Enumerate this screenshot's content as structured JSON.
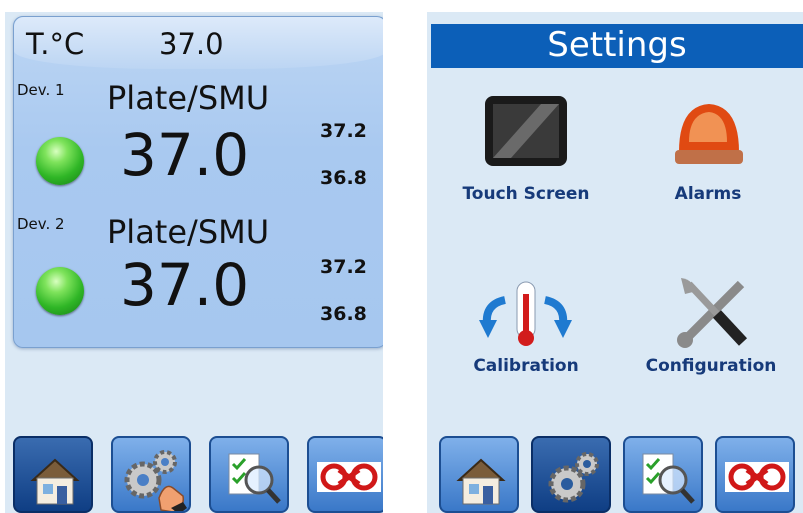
{
  "left_screen": {
    "header": {
      "label": "T.°C",
      "value": "37.0"
    },
    "devices": [
      {
        "label": "Dev. 1",
        "name": "Plate/SMU",
        "current": "37.0",
        "high": "37.2",
        "low": "36.8",
        "status": "ok"
      },
      {
        "label": "Dev. 2",
        "name": "Plate/SMU",
        "current": "37.0",
        "high": "37.2",
        "low": "36.8",
        "status": "ok"
      }
    ]
  },
  "right_screen": {
    "title": "Settings",
    "tiles": [
      {
        "label": "Touch Screen",
        "icon": "touch-screen-icon"
      },
      {
        "label": "Alarms",
        "icon": "alarm-light-icon"
      },
      {
        "label": "Calibration",
        "icon": "thermometer-icon"
      },
      {
        "label": "Configuration",
        "icon": "wrench-screwdriver-icon"
      }
    ]
  },
  "nav": {
    "left_active": "home",
    "right_active": "settings",
    "buttons": [
      "home-icon",
      "settings-gears-icon",
      "report-search-icon",
      "company-logo-icon"
    ]
  },
  "colors": {
    "panel_bg": "#dbe9f5",
    "card_bg": "#a9c9f0",
    "settings_bar": "#0c5fb8",
    "tile_label": "#163a7a",
    "led_green": "#2fb626"
  }
}
